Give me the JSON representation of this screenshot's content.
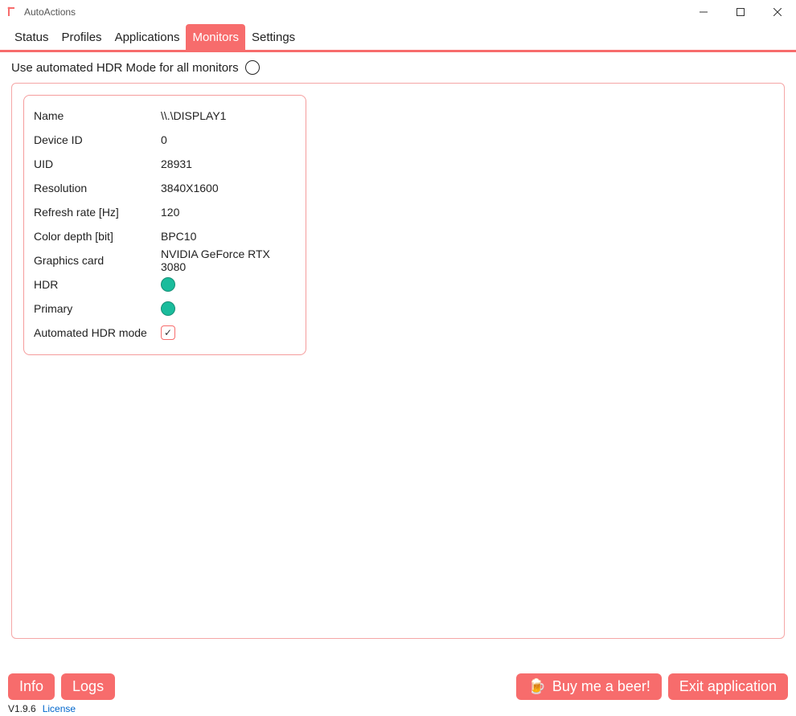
{
  "window": {
    "title": "AutoActions"
  },
  "tabs": [
    "Status",
    "Profiles",
    "Applications",
    "Monitors",
    "Settings"
  ],
  "active_tab_index": 3,
  "toprow": {
    "label": "Use automated HDR Mode for all monitors"
  },
  "monitor": {
    "rows": [
      {
        "label": "Name",
        "value": "\\\\.\\DISPLAY1"
      },
      {
        "label": "Device ID",
        "value": "0"
      },
      {
        "label": "UID",
        "value": "28931"
      },
      {
        "label": "Resolution",
        "value": "3840X1600"
      },
      {
        "label": "Refresh rate [Hz]",
        "value": "120"
      },
      {
        "label": "Color depth [bit]",
        "value": "BPC10"
      },
      {
        "label": "Graphics card",
        "value": "NVIDIA GeForce RTX 3080"
      }
    ],
    "hdr_label": "HDR",
    "primary_label": "Primary",
    "auto_hdr_label": "Automated HDR mode",
    "hdr_on": true,
    "primary_on": true,
    "auto_hdr_checked": true
  },
  "buttons": {
    "info": "Info",
    "logs": "Logs",
    "beer": "Buy me a beer!",
    "exit": "Exit application"
  },
  "status": {
    "version": "V1.9.6",
    "license": "License"
  }
}
